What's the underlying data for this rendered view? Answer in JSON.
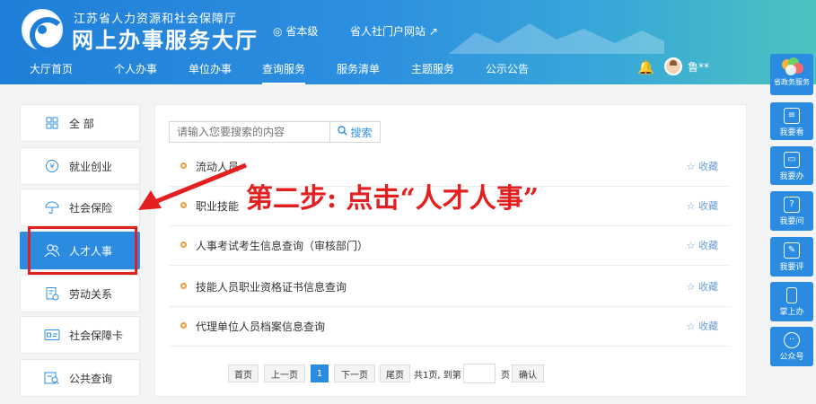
{
  "header": {
    "org_name": "江苏省人力资源和社会保障厅",
    "hall_title": "网上办事服务大厅",
    "region": "省本级",
    "portal_link": "省人社门户网站",
    "username": "鲁**",
    "nav": [
      "大厅首页",
      "个人办事",
      "单位办事",
      "查询服务",
      "服务清单",
      "主题服务",
      "公示公告"
    ],
    "active_nav": "查询服务"
  },
  "sidebar": {
    "items": [
      {
        "label": "全 部",
        "icon": "grid-icon"
      },
      {
        "label": "就业创业",
        "icon": "briefcase-icon"
      },
      {
        "label": "社会保险",
        "icon": "umbrella-icon"
      },
      {
        "label": "人才人事",
        "icon": "people-icon"
      },
      {
        "label": "劳动关系",
        "icon": "document-icon"
      },
      {
        "label": "社会保障卡",
        "icon": "card-icon"
      },
      {
        "label": "公共查询",
        "icon": "search-doc-icon"
      }
    ],
    "active": "人才人事"
  },
  "search": {
    "placeholder": "请输入您要搜索的内容",
    "button": "搜索"
  },
  "results": [
    {
      "title": "流动人员",
      "fav": "收藏"
    },
    {
      "title": "职业技能",
      "fav": "收藏"
    },
    {
      "title": "人事考试考生信息查询（审核部门）",
      "fav": "收藏"
    },
    {
      "title": "技能人员职业资格证书信息查询",
      "fav": "收藏"
    },
    {
      "title": "代理单位人员档案信息查询",
      "fav": "收藏"
    }
  ],
  "pagination": {
    "first": "首页",
    "prev": "上一页",
    "current": "1",
    "next": "下一页",
    "last": "尾页",
    "total": "共1页, 到第",
    "page_unit": "页",
    "confirm": "确认"
  },
  "annotation": "第二步: 点击“人才人事”",
  "right_bar": {
    "top": "省政务服务",
    "items": [
      {
        "label": "我要看",
        "icon": "book-icon"
      },
      {
        "label": "我要办",
        "icon": "monitor-icon"
      },
      {
        "label": "我要问",
        "icon": "question-icon"
      },
      {
        "label": "我要评",
        "icon": "edit-icon"
      },
      {
        "label": "掌上办",
        "icon": "phone-icon"
      },
      {
        "label": "公众号",
        "icon": "wechat-icon"
      }
    ]
  },
  "colors": {
    "primary": "#2b8be0",
    "annotation_red": "#e41f1f",
    "bullet_orange": "#f09a3e"
  }
}
